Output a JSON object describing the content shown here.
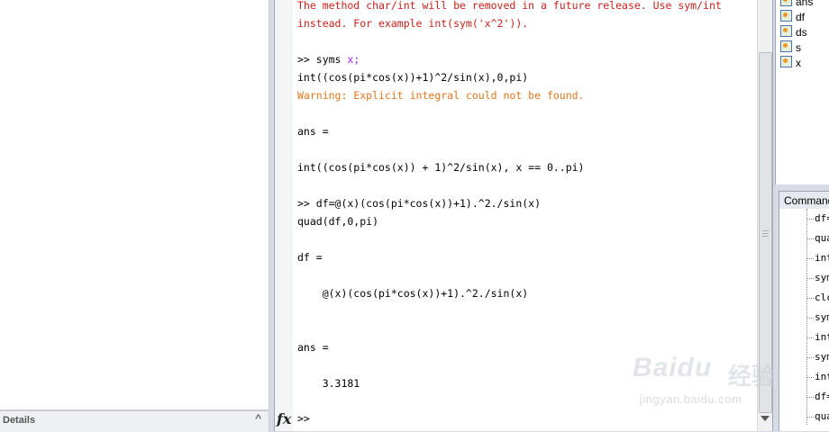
{
  "left_panel": {
    "details_label": "Details",
    "details_toggle": "^"
  },
  "command_window": {
    "lines": [
      {
        "text": "The method char/int will be removed in a future release. Use sym/int",
        "style": "red"
      },
      {
        "text": "instead. For example int(sym('x^2')).",
        "style": "red"
      },
      {
        "text": "",
        "style": "normal"
      },
      {
        "text": ">> syms x;",
        "style": "syms"
      },
      {
        "text": "int((cos(pi*cos(x))+1)^2/sin(x),0,pi)",
        "style": "normal"
      },
      {
        "text": "Warning: Explicit integral could not be found.",
        "style": "orange"
      },
      {
        "text": "",
        "style": "normal"
      },
      {
        "text": "ans =",
        "style": "normal"
      },
      {
        "text": "",
        "style": "normal"
      },
      {
        "text": "int((cos(pi*cos(x)) + 1)^2/sin(x), x == 0..pi)",
        "style": "normal"
      },
      {
        "text": "",
        "style": "normal"
      },
      {
        "text": ">> df=@(x)(cos(pi*cos(x))+1).^2./sin(x)",
        "style": "normal"
      },
      {
        "text": "quad(df,0,pi)",
        "style": "normal"
      },
      {
        "text": "",
        "style": "normal"
      },
      {
        "text": "df =",
        "style": "normal"
      },
      {
        "text": "",
        "style": "normal"
      },
      {
        "text": "    @(x)(cos(pi*cos(x))+1).^2./sin(x)",
        "style": "normal"
      },
      {
        "text": "",
        "style": "normal"
      },
      {
        "text": "",
        "style": "normal"
      },
      {
        "text": "ans =",
        "style": "normal"
      },
      {
        "text": "",
        "style": "normal"
      },
      {
        "text": "    3.3181",
        "style": "normal"
      }
    ],
    "syms_prefix": ">> syms ",
    "syms_var": "x;",
    "fx_label": "fx",
    "prompt": ">>"
  },
  "workspace": {
    "variables": [
      "ans",
      "df",
      "ds",
      "s",
      "x"
    ]
  },
  "history": {
    "title": "Command History",
    "items": [
      "df=",
      "quad",
      "int",
      "syms",
      "clc",
      "syms",
      "int",
      "syms",
      "int",
      "df=",
      "quad"
    ]
  },
  "watermark": {
    "logo": "Baidu",
    "cn": "经验",
    "url": "jingyan.baidu.com"
  }
}
